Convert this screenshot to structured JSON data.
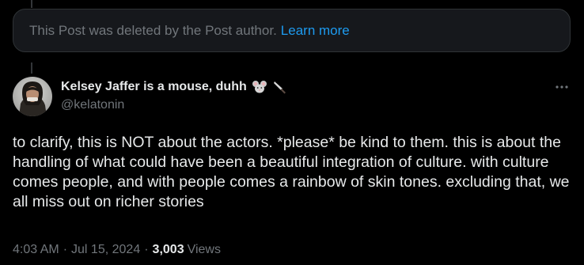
{
  "deleted_notice": {
    "text": "This Post was deleted by the Post author.",
    "link_label": "Learn more"
  },
  "author": {
    "display_name": "Kelsey Jaffer is a mouse, duhh",
    "emojis": [
      "mouse-icon",
      "knife-icon"
    ],
    "handle": "@kelatonin"
  },
  "post": {
    "text": "to clarify, this is NOT about the actors. *please* be kind to them. this is about the handling of what could have been a beautiful integration of culture. with culture comes people, and with people comes a rainbow of skin tones. excluding that, we all miss out on richer stories"
  },
  "meta": {
    "time": "4:03 AM",
    "date": "Jul 15, 2024",
    "separator": "·",
    "views_count": "3,003",
    "views_label": "Views"
  },
  "colors": {
    "background": "#000000",
    "text_primary": "#e7e9ea",
    "text_secondary": "#71767b",
    "link": "#1d9bf0",
    "deleted_box_bg": "#16181c"
  }
}
